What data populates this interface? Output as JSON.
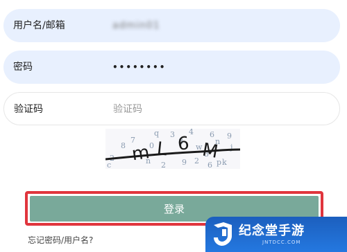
{
  "form": {
    "username": {
      "label": "用户名/邮箱",
      "value": "admin01"
    },
    "password": {
      "label": "密码",
      "value": "••••••••"
    },
    "captcha": {
      "label": "验证码",
      "placeholder": "验证码"
    },
    "captcha_image": {
      "main_chars": [
        "m",
        "L",
        "6",
        "M"
      ],
      "noise_chars": [
        "q",
        "8",
        "3",
        "9",
        "7",
        "0",
        "4",
        "j",
        "n",
        "2",
        "8",
        "6",
        "3",
        "c",
        "p",
        "k",
        "n",
        "9",
        "w",
        "2",
        "2",
        "6"
      ]
    },
    "login_button": "登录",
    "forgot_link": "忘记密码/用户名?"
  },
  "watermark": {
    "brand_text": "纪念堂手游",
    "url_text": "JNTDCC.COM",
    "logo_icon": "j-logo-icon"
  },
  "colors": {
    "filled_field_bg": "#e8f0fe",
    "login_button_bg": "#79a99a",
    "highlight_border": "#e0353d",
    "watermark_bg": "#2478e0"
  }
}
